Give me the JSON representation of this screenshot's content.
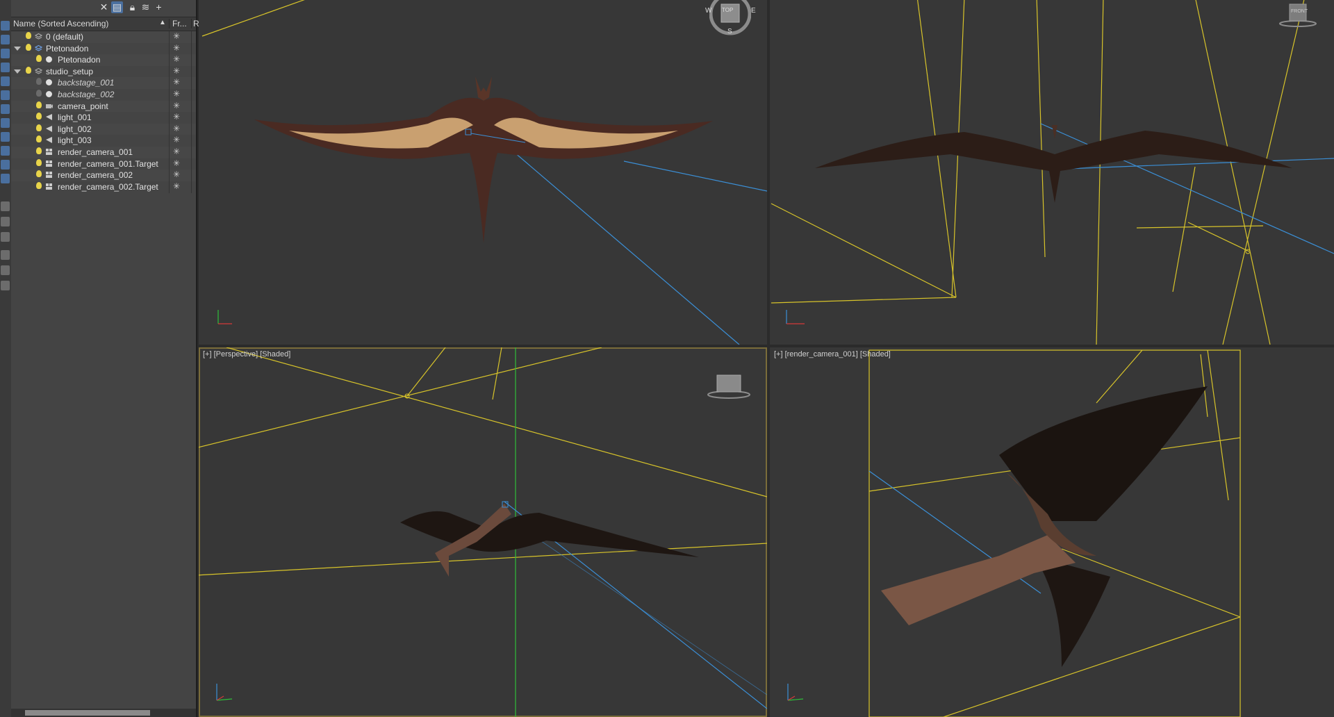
{
  "scene_explorer": {
    "header": {
      "name_col": "Name (Sorted Ascending)",
      "sort_arrow": "▲",
      "freeze_col": "Fr...",
      "extra_col": "R"
    },
    "toolbar": {
      "close": "✕",
      "add": "+"
    },
    "items": [
      {
        "label": "0 (default)",
        "italic": false,
        "light_on": true
      },
      {
        "label": "Ptetonadon",
        "italic": false,
        "light_on": true
      },
      {
        "label": "Ptetonadon",
        "italic": false,
        "light_on": true
      },
      {
        "label": "studio_setup",
        "italic": false,
        "light_on": true
      },
      {
        "label": "backstage_001",
        "italic": true,
        "light_on": false
      },
      {
        "label": "backstage_002",
        "italic": true,
        "light_on": false
      },
      {
        "label": "camera_point",
        "italic": false,
        "light_on": true
      },
      {
        "label": "light_001",
        "italic": false,
        "light_on": true
      },
      {
        "label": "light_002",
        "italic": false,
        "light_on": true
      },
      {
        "label": "light_003",
        "italic": false,
        "light_on": true
      },
      {
        "label": "render_camera_001",
        "italic": false,
        "light_on": true
      },
      {
        "label": "render_camera_001.Target",
        "italic": false,
        "light_on": true
      },
      {
        "label": "render_camera_002",
        "italic": false,
        "light_on": true
      },
      {
        "label": "render_camera_002.Target",
        "italic": false,
        "light_on": true
      }
    ],
    "freeze_glyph": "✳"
  },
  "viewports": {
    "top_left": {
      "label": "",
      "cube_letters": {
        "w": "W",
        "e": "E",
        "s": "S",
        "face": "TOP"
      }
    },
    "top_right": {
      "label": "",
      "cube_face": "FRONT"
    },
    "bottom_left": {
      "label": "[+] [Perspective] [Shaded]"
    },
    "bottom_right": {
      "label": "[+] [render_camera_001] [Shaded]"
    }
  },
  "colors": {
    "viewport_bg": "#373737",
    "wire_yellow": "#d8c42a",
    "wire_blue": "#3b8fd6",
    "wire_green": "#2fbf3a",
    "bulb_on": "#e8d44a"
  }
}
